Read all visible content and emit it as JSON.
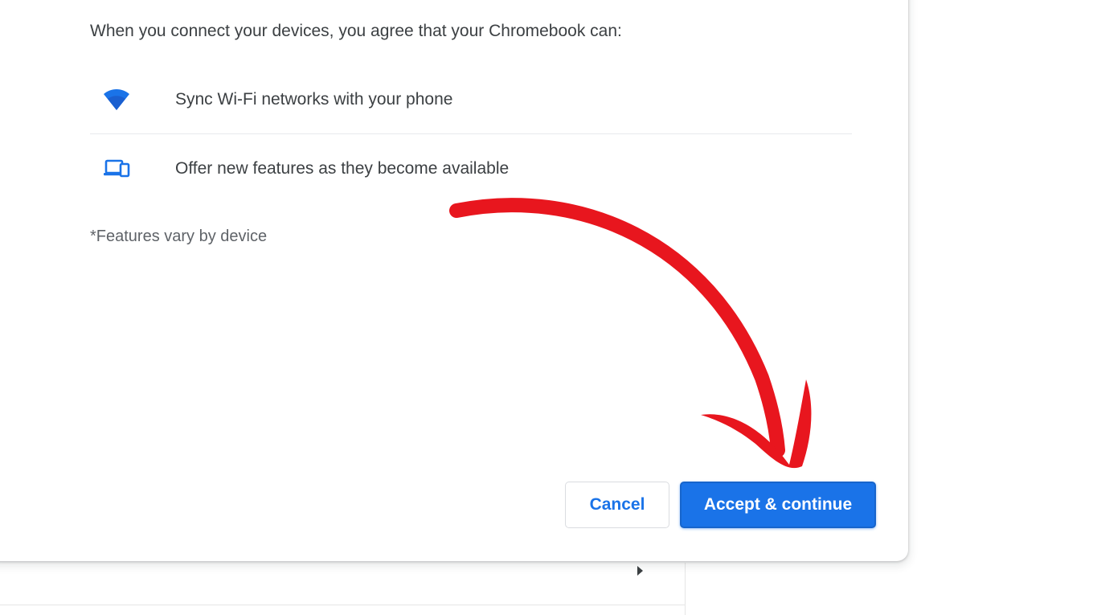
{
  "dialog": {
    "intro_text": "When you connect your devices, you agree that your Chromebook can:",
    "features": [
      {
        "icon": "wifi-icon",
        "label": "Sync Wi-Fi networks with your phone"
      },
      {
        "icon": "devices-icon",
        "label": "Offer new features as they become available"
      }
    ],
    "footnote": "*Features vary by device",
    "buttons": {
      "cancel_label": "Cancel",
      "accept_label": "Accept & continue"
    }
  },
  "colors": {
    "accent": "#1a73e8",
    "text": "#3c4043",
    "secondary_text": "#5f6368",
    "annotation_arrow": "#e8161e"
  },
  "annotation": {
    "icon": "red-arrow-annotation",
    "points_to": "Accept & continue"
  }
}
